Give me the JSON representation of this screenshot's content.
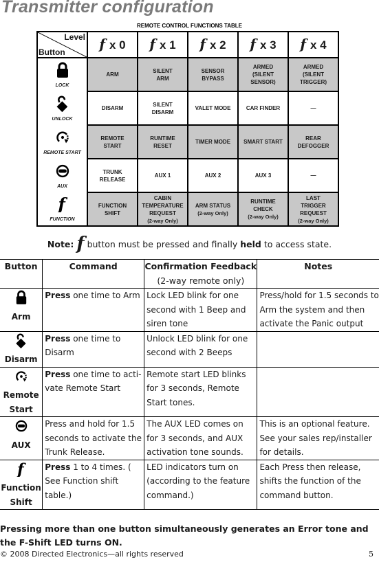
{
  "page": {
    "title": "Transmitter configuration",
    "page_number": "5",
    "footer": "© 2008 Directed Electronics—all rights reserved"
  },
  "functions_table": {
    "caption": "REMOTE CONTROL FUNCTIONS TABLE",
    "corner_level": "Level",
    "corner_button": "Button",
    "levels": [
      "x 0",
      "x 1",
      "x 2",
      "x 3",
      "x 4"
    ],
    "rows": [
      {
        "button": "LOCK",
        "icon": "lock-icon",
        "shade": "gray",
        "cells": [
          [
            "ARM"
          ],
          [
            "SILENT",
            "ARM"
          ],
          [
            "SENSOR",
            "BYPASS"
          ],
          [
            "ARMED",
            "(SILENT",
            "SENSOR)"
          ],
          [
            "ARMED",
            "(SILENT",
            "TRIGGER)"
          ]
        ]
      },
      {
        "button": "UNLOCK",
        "icon": "unlock-icon",
        "shade": "white",
        "cells": [
          [
            "DISARM"
          ],
          [
            "SILENT",
            "DISARM"
          ],
          [
            "VALET MODE"
          ],
          [
            "CAR FINDER"
          ],
          [
            "—"
          ]
        ]
      },
      {
        "button": "REMOTE START",
        "icon": "remote-start-icon",
        "shade": "gray",
        "cells": [
          [
            "REMOTE",
            "START"
          ],
          [
            "RUNTIME",
            "RESET"
          ],
          [
            "TIMER MODE"
          ],
          [
            "SMART START"
          ],
          [
            "REAR",
            "DEFOGGER"
          ]
        ]
      },
      {
        "button": "AUX",
        "icon": "aux-icon",
        "shade": "white",
        "cells": [
          [
            "TRUNK",
            "RELEASE"
          ],
          [
            "AUX 1"
          ],
          [
            "AUX 2"
          ],
          [
            "AUX 3"
          ],
          [
            "—"
          ]
        ]
      },
      {
        "button": "FUNCTION",
        "icon": "function-icon",
        "shade": "gray",
        "cells": [
          [
            "FUNCTION",
            "SHIFT"
          ],
          [
            "CABIN",
            "TEMPERATURE",
            "REQUEST",
            "(2-way Only)"
          ],
          [
            "ARM STATUS",
            "(2-way Only)"
          ],
          [
            "RUNTIME",
            "CHECK",
            "(2-way Only)"
          ],
          [
            "LAST",
            "TRIGGER",
            "REQUEST",
            "(2-way Only)"
          ]
        ]
      }
    ]
  },
  "note": {
    "prefix": "Note:",
    "text_before_bold": " button must be pressed and finally ",
    "bold": "held",
    "text_after_bold": " to access state."
  },
  "command_table": {
    "headers": {
      "button": "Button",
      "command": "Command",
      "feedback": "Confirmation Feedback",
      "feedback_sub": "(2-way remote only)",
      "notes": "Notes"
    },
    "rows": [
      {
        "button": "Arm",
        "icon": "lock-icon",
        "command_bold": "Press",
        "command": " one time to Arm",
        "feedback": "Lock LED blink for one second with 1 Beep and siren tone",
        "notes": "Press/hold for 1.5 seconds to Arm the system and then activate the Panic output"
      },
      {
        "button": "Disarm",
        "icon": "unlock-icon",
        "command_bold": "Press",
        "command": " one time to Disarm",
        "feedback": "Unlock LED blink for one second with 2 Beeps",
        "notes": ""
      },
      {
        "button": "Remote Start",
        "icon": "remote-start-icon",
        "command_bold": "Press",
        "command": " one time to acti-vate Remote Start",
        "feedback": "Remote start LED blinks for 3 seconds, Remote Start tones.",
        "notes": ""
      },
      {
        "button": "AUX",
        "icon": "aux-icon",
        "command_bold": "",
        "command": "Press and hold for 1.5 seconds to activate the Trunk Release.",
        "feedback": "The AUX LED comes on for 3 seconds, and AUX activation tone sounds.",
        "notes": "This is an optional feature. See your sales rep/installer for details."
      },
      {
        "button": "Function Shift",
        "icon": "function-icon",
        "command_bold": "Press",
        "command": " 1 to 4 times. ( See Function shift table.)",
        "feedback": "LED indicators turn on (according to the feature command.)",
        "notes": "Each Press then release, shifts the function of the command button."
      }
    ]
  },
  "warning": "Pressing more than one button simultaneously generates an Error tone and the F-Shift LED turns ON."
}
